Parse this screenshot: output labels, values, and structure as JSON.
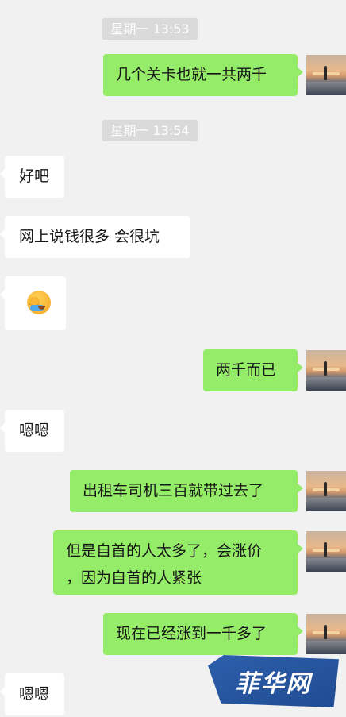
{
  "timestamps": [
    "星期一 13:53",
    "星期一 13:54"
  ],
  "messages": [
    {
      "side": "right",
      "text": "几个关卡也就一共两千"
    },
    {
      "side": "left",
      "text": "好吧"
    },
    {
      "side": "left",
      "text": "网上说钱很多 会很坑"
    },
    {
      "side": "left",
      "icon": "face-with-tears-emoji"
    },
    {
      "side": "right",
      "text": "两千而已"
    },
    {
      "side": "left",
      "text": "嗯嗯"
    },
    {
      "side": "right",
      "text": "出租车司机三百就带过去了"
    },
    {
      "side": "right",
      "text": "但是自首的人太多了，会涨价",
      "text2": "，因为自首的人紧张"
    },
    {
      "side": "right",
      "text": "现在已经涨到一千多了"
    },
    {
      "side": "left",
      "text": "嗯嗯"
    }
  ],
  "watermark": "菲华网",
  "colors": {
    "background": "#f1f1f1",
    "outgoing": "#95ec69",
    "incoming": "#ffffff",
    "timestamp": "#dadada"
  }
}
